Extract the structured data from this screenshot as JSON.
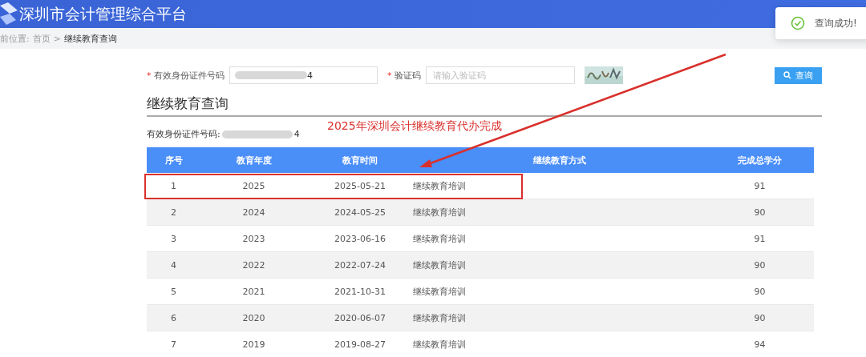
{
  "header": {
    "title": "深圳市会计管理综合平台"
  },
  "breadcrumb": {
    "prefix": "前位置:",
    "items": [
      {
        "label": "首页",
        "current": false
      },
      {
        "label": "继续教育查询",
        "current": true
      }
    ],
    "separator": ">"
  },
  "toast": {
    "message": "查询成功!"
  },
  "form": {
    "id_field": {
      "mark": "*",
      "label": "有效身份证件号码",
      "value": "4"
    },
    "captcha_field": {
      "mark": "*",
      "label": "验证码",
      "placeholder": "请输入验证码"
    },
    "search_button": "查询"
  },
  "section_title": "继续教育查询",
  "id_line": {
    "label": "有效身份证件号码:",
    "value": "4"
  },
  "annotation": {
    "text": "2025年深圳会计继续教育代办完成"
  },
  "table": {
    "columns": [
      "序号",
      "教育年度",
      "教育时间",
      "继续教育方式",
      "完成总学分"
    ],
    "rows": [
      {
        "cells": [
          "1",
          "2025",
          "2025-05-21",
          "继续教育培训",
          "91"
        ],
        "highlighted": true
      },
      {
        "cells": [
          "2",
          "2024",
          "2024-05-25",
          "继续教育培训",
          "90"
        ],
        "highlighted": false
      },
      {
        "cells": [
          "3",
          "2023",
          "2023-06-16",
          "继续教育培训",
          "91"
        ],
        "highlighted": false
      },
      {
        "cells": [
          "4",
          "2022",
          "2022-07-24",
          "继续教育培训",
          "90"
        ],
        "highlighted": false
      },
      {
        "cells": [
          "5",
          "2021",
          "2021-10-31",
          "继续教育培训",
          "90"
        ],
        "highlighted": false
      },
      {
        "cells": [
          "6",
          "2020",
          "2020-06-07",
          "继续教育培训",
          "90"
        ],
        "highlighted": false
      },
      {
        "cells": [
          "7",
          "2019",
          "2019-08-27",
          "继续教育培训",
          "94"
        ],
        "highlighted": false
      }
    ]
  }
}
